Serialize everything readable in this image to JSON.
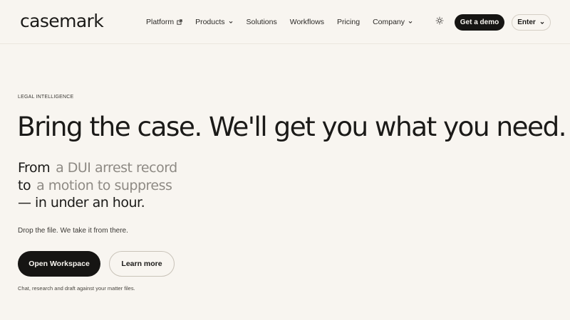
{
  "brand": {
    "logo_text": "casemark"
  },
  "nav": {
    "items": [
      {
        "label": "Platform",
        "icon": "external-link-icon"
      },
      {
        "label": "Products",
        "icon": "chevron-down-icon"
      },
      {
        "label": "Solutions"
      },
      {
        "label": "Workflows"
      },
      {
        "label": "Pricing"
      },
      {
        "label": "Company",
        "icon": "chevron-down-icon"
      }
    ],
    "theme_toggle_icon": "sun-icon",
    "demo_label": "Get a demo",
    "enter_label": "Enter",
    "enter_icon": "chevron-down-icon"
  },
  "hero": {
    "eyebrow": "LEGAL INTELLIGENCE",
    "headline": "Bring the case. We'll get you what you need.",
    "sub": {
      "from_word": "From",
      "from_value": "a DUI arrest record",
      "to_word": "to",
      "to_value": "a motion to suppress",
      "closing": "— in under an hour."
    },
    "tagline": "Drop the file. We take it from there.",
    "primary_cta": "Open Workspace",
    "secondary_cta": "Learn more",
    "footnote": "Chat, research and draft against your matter files."
  },
  "colors": {
    "background": "#f8f5f0",
    "text": "#1b1a18",
    "muted_text": "#8e8a84",
    "button_dark": "#161513",
    "border": "#c9c3b9"
  }
}
